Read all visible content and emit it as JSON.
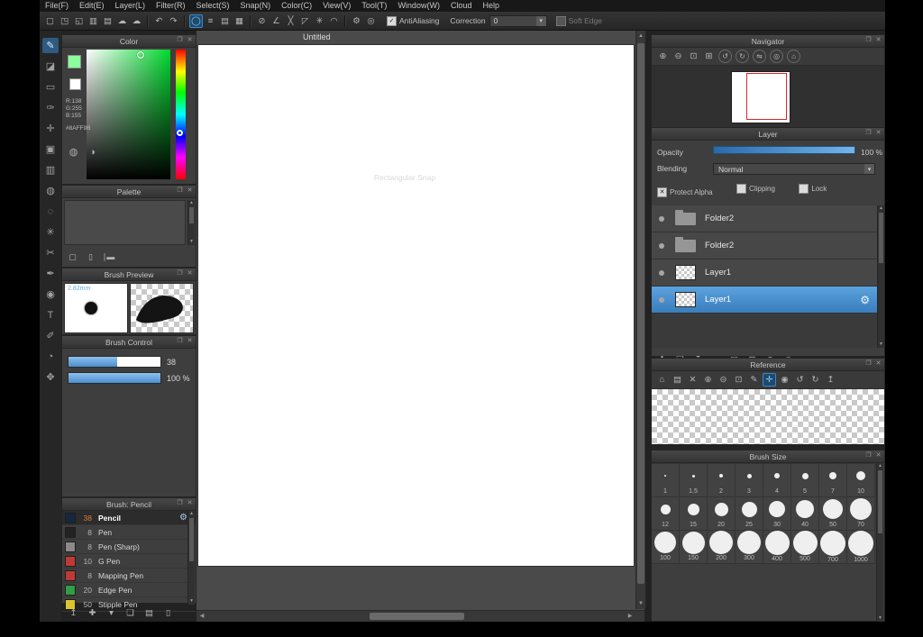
{
  "ui": {
    "dropdown_arrow": "▾",
    "aa_check": "✓",
    "check_mark": "✕"
  },
  "panel": {
    "float_icon": "❐",
    "close_icon": "✕"
  },
  "scroll": {
    "up": "▲",
    "down": "▼",
    "left": "◀",
    "right": "▶"
  },
  "menu": {
    "items": [
      "File(F)",
      "Edit(E)",
      "Layer(L)",
      "Filter(R)",
      "Select(S)",
      "Snap(N)",
      "Color(C)",
      "View(V)",
      "Tool(T)",
      "Window(W)",
      "Cloud",
      "Help"
    ]
  },
  "toolbar": {
    "file_icons": [
      {
        "name": "new-canvas-icon",
        "glyph": "▢"
      },
      {
        "name": "open-file-icon",
        "glyph": "◳"
      },
      {
        "name": "save-file-icon",
        "glyph": "◱"
      },
      {
        "name": "save-as-icon",
        "glyph": "▥"
      },
      {
        "name": "export-icon",
        "glyph": "▤"
      },
      {
        "name": "cloud-upload-icon",
        "glyph": "☁"
      },
      {
        "name": "cloud-download-icon",
        "glyph": "☁"
      }
    ],
    "history_icons": [
      {
        "name": "undo-icon",
        "glyph": "↶"
      },
      {
        "name": "redo-icon",
        "glyph": "↷"
      }
    ],
    "stroke_icons": [
      {
        "name": "freehand-icon",
        "glyph": "◯",
        "selected": true
      },
      {
        "name": "parallel-lines-icon",
        "glyph": "≡"
      },
      {
        "name": "hatch-icon",
        "glyph": "▤"
      },
      {
        "name": "grid-icon",
        "glyph": "▦"
      }
    ],
    "snap_icons": [
      {
        "name": "snap-off-icon",
        "glyph": "⊘"
      },
      {
        "name": "snap-parallel-icon",
        "glyph": "∠"
      },
      {
        "name": "snap-crisscross-icon",
        "glyph": "╳"
      },
      {
        "name": "snap-vanishing-icon",
        "glyph": "◸"
      },
      {
        "name": "snap-radial-icon",
        "glyph": "✳"
      },
      {
        "name": "snap-curve-icon",
        "glyph": "◠"
      }
    ],
    "option_icons": [
      {
        "name": "snap-settings-icon",
        "glyph": "⚙"
      },
      {
        "name": "symmetry-icon",
        "glyph": "◎"
      }
    ],
    "antialiasing_label": "AntiAliasing",
    "correction_label": "Correction",
    "correction_value": "0",
    "soft_edge_label": "Soft Edge"
  },
  "tools": [
    {
      "name": "pen-tool",
      "glyph": "✎",
      "selected": true
    },
    {
      "name": "eraser-tool",
      "glyph": "◪"
    },
    {
      "name": "select-rect-tool",
      "glyph": "▭"
    },
    {
      "name": "brush-tool",
      "glyph": "✑"
    },
    {
      "name": "move-tool",
      "glyph": "✛"
    },
    {
      "name": "fill-rect-tool",
      "glyph": "▣"
    },
    {
      "name": "gradient-tool",
      "glyph": "▥"
    },
    {
      "name": "bucket-tool",
      "glyph": "◍"
    },
    {
      "name": "lasso-select-tool",
      "glyph": "◌"
    },
    {
      "name": "magic-wand-tool",
      "glyph": "✳"
    },
    {
      "name": "divide-tool",
      "glyph": "✂"
    },
    {
      "name": "snap-pen-tool",
      "glyph": "✒"
    },
    {
      "name": "dot-pen-tool",
      "glyph": "◉"
    },
    {
      "name": "text-tool",
      "glyph": "T"
    },
    {
      "name": "select-pen-tool",
      "glyph": "✐"
    },
    {
      "name": "eyedropper-tool",
      "glyph": "◔"
    },
    {
      "name": "hand-tool",
      "glyph": "✥"
    }
  ],
  "canvas": {
    "title": "Untitled",
    "watermark": "Rectangular Snap"
  },
  "color": {
    "title": "Color",
    "r": "R:138",
    "g": "G:255",
    "b": "B:155",
    "hex": "#8AFF9B",
    "fg": "#8AFF9B",
    "bg": "#FFFFFF",
    "icons": [
      {
        "name": "color-wheel-icon",
        "glyph": "◍"
      },
      {
        "name": "color-bar-icon",
        "glyph": "◑"
      }
    ]
  },
  "palette": {
    "title": "Palette",
    "icons": [
      {
        "name": "add-color-icon",
        "glyph": "▢"
      },
      {
        "name": "delete-color-icon",
        "glyph": "▯"
      },
      {
        "name": "palette-line-icon",
        "glyph": "∣▬"
      }
    ]
  },
  "brush_preview": {
    "title": "Brush Preview",
    "size": "2.82mm"
  },
  "brush_control": {
    "title": "Brush Control",
    "size_value": "38",
    "size_pct": 53,
    "opacity_value": "100 %",
    "opacity_pct": 100
  },
  "brush_panel": {
    "title": "Brush: Pencil",
    "brushes": [
      {
        "size": "38",
        "name": "Pencil",
        "color": "#16283c",
        "selected": true
      },
      {
        "size": "8",
        "name": "Pen",
        "color": "#232323"
      },
      {
        "size": "8",
        "name": "Pen (Sharp)",
        "color": "#8a8a8a"
      },
      {
        "size": "10",
        "name": "G Pen",
        "color": "#c03a34"
      },
      {
        "size": "8",
        "name": "Mapping Pen",
        "color": "#c03a34"
      },
      {
        "size": "20",
        "name": "Edge Pen",
        "color": "#2f9e44"
      },
      {
        "size": "50",
        "name": "Stipple Pen",
        "color": "#d8c52e"
      }
    ],
    "icons": [
      {
        "name": "brush-up-icon",
        "glyph": "↥"
      },
      {
        "name": "add-brush-icon",
        "glyph": "✚"
      },
      {
        "name": "brush-menu-icon",
        "glyph": "▾"
      },
      {
        "name": "duplicate-brush-icon",
        "glyph": "❏"
      },
      {
        "name": "brush-folder-icon",
        "glyph": "▤"
      },
      {
        "name": "delete-brush-icon",
        "glyph": "▯"
      }
    ]
  },
  "navigator": {
    "title": "Navigator",
    "icons": [
      {
        "name": "nav-zoom-in-icon",
        "glyph": "⊕"
      },
      {
        "name": "nav-zoom-out-icon",
        "glyph": "⊖"
      },
      {
        "name": "nav-fit-icon",
        "glyph": "⊡"
      },
      {
        "name": "nav-actual-size-icon",
        "glyph": "⊞"
      },
      {
        "name": "nav-rotate-ccw-icon",
        "glyph": "↺",
        "round": true
      },
      {
        "name": "nav-rotate-cw-icon",
        "glyph": "↻",
        "round": true
      },
      {
        "name": "nav-flip-icon",
        "glyph": "⇋",
        "round": true
      },
      {
        "name": "nav-reset-rotation-icon",
        "glyph": "◎",
        "round": true
      },
      {
        "name": "nav-reset-view-icon",
        "glyph": "⌂",
        "round": true
      }
    ]
  },
  "layer": {
    "title": "Layer",
    "opacity_label": "Opacity",
    "opacity_value": "100 %",
    "blending_label": "Blending",
    "blending_value": "Normal",
    "protect_alpha_label": "Protect Alpha",
    "clipping_label": "Clipping",
    "lock_label": "Lock",
    "layers": [
      {
        "name": "Folder2",
        "type": "folder"
      },
      {
        "name": "Folder2",
        "type": "folder"
      },
      {
        "name": "Layer1",
        "type": "layer"
      },
      {
        "name": "Layer1",
        "type": "layer",
        "selected": true
      }
    ],
    "toolbar_icons": [
      {
        "name": "new-layer-icon",
        "glyph": "✚"
      },
      {
        "name": "duplicate-layer-icon",
        "glyph": "❏"
      },
      {
        "name": "transfer-layer-icon",
        "glyph": "↧"
      },
      {
        "name": "layer-menu-icon",
        "glyph": "▾"
      },
      {
        "name": "new-folder-icon",
        "glyph": "▤"
      },
      {
        "name": "merge-layer-icon",
        "glyph": "⊞"
      },
      {
        "name": "clear-layer-icon",
        "glyph": "⊘"
      },
      {
        "name": "delete-layer-icon",
        "glyph": "▯"
      }
    ]
  },
  "reference": {
    "title": "Reference",
    "icons": [
      {
        "name": "ref-home-icon",
        "glyph": "⌂"
      },
      {
        "name": "ref-open-icon",
        "glyph": "▤"
      },
      {
        "name": "ref-close-icon",
        "glyph": "✕"
      },
      {
        "name": "ref-zoom-in-icon",
        "glyph": "⊕"
      },
      {
        "name": "ref-zoom-out-icon",
        "glyph": "⊖"
      },
      {
        "name": "ref-fit-icon",
        "glyph": "⊡"
      },
      {
        "name": "ref-pencil-icon",
        "glyph": "✎"
      },
      {
        "name": "ref-hand-icon",
        "glyph": "✛",
        "selected": true
      },
      {
        "name": "ref-eye-icon",
        "glyph": "◉"
      },
      {
        "name": "ref-rotate-ccw-icon",
        "glyph": "↺"
      },
      {
        "name": "ref-rotate-cw-icon",
        "glyph": "↻"
      },
      {
        "name": "ref-export-icon",
        "glyph": "↥"
      }
    ]
  },
  "brush_size": {
    "title": "Brush Size",
    "sizes": [
      {
        "label": "1",
        "d": 2
      },
      {
        "label": "1.5",
        "d": 3
      },
      {
        "label": "2",
        "d": 4
      },
      {
        "label": "3",
        "d": 5
      },
      {
        "label": "4",
        "d": 6
      },
      {
        "label": "5",
        "d": 7
      },
      {
        "label": "7",
        "d": 8
      },
      {
        "label": "10",
        "d": 10
      },
      {
        "label": "12",
        "d": 11
      },
      {
        "label": "15",
        "d": 13
      },
      {
        "label": "20",
        "d": 15
      },
      {
        "label": "25",
        "d": 17
      },
      {
        "label": "30",
        "d": 18
      },
      {
        "label": "40",
        "d": 20
      },
      {
        "label": "50",
        "d": 22
      },
      {
        "label": "70",
        "d": 24
      },
      {
        "label": "100",
        "d": 24
      },
      {
        "label": "150",
        "d": 25
      },
      {
        "label": "200",
        "d": 26
      },
      {
        "label": "300",
        "d": 26
      },
      {
        "label": "400",
        "d": 27
      },
      {
        "label": "500",
        "d": 27
      },
      {
        "label": "700",
        "d": 28
      },
      {
        "label": "1000",
        "d": 28
      }
    ]
  }
}
